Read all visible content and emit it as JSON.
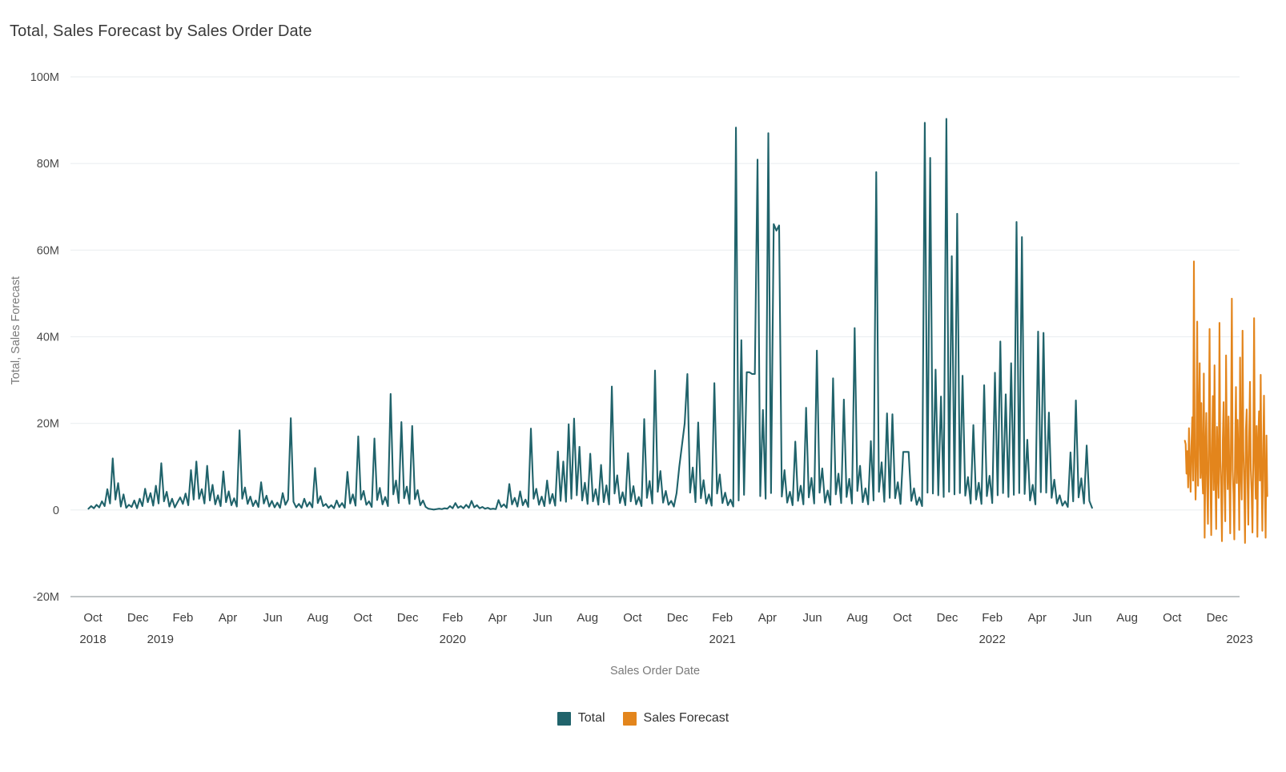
{
  "chart_data": {
    "type": "line",
    "title": "Total, Sales Forecast by Sales Order Date",
    "xlabel": "Sales Order Date",
    "ylabel": "Total, Sales Forecast",
    "ylim": [
      -20000000,
      100000000
    ],
    "ytick_labels": [
      "100M",
      "80M",
      "60M",
      "40M",
      "20M",
      "0",
      "-20M"
    ],
    "ytick_values": [
      100000000,
      80000000,
      60000000,
      40000000,
      20000000,
      0,
      -20000000
    ],
    "grid": true,
    "legend_position": "bottom",
    "xlim_months": [
      "2018-09",
      "2023-01"
    ],
    "xtick_labels": [
      "Oct",
      "Dec",
      "Feb",
      "Apr",
      "Jun",
      "Aug",
      "Oct",
      "Dec",
      "Feb",
      "Apr",
      "Jun",
      "Aug",
      "Oct",
      "Dec",
      "Feb",
      "Apr",
      "Jun",
      "Aug",
      "Oct",
      "Dec",
      "Feb",
      "Apr",
      "Jun",
      "Aug",
      "Oct",
      "Dec"
    ],
    "xtick_months": [
      "2018-10",
      "2018-12",
      "2019-02",
      "2019-04",
      "2019-06",
      "2019-08",
      "2019-10",
      "2019-12",
      "2020-02",
      "2020-04",
      "2020-06",
      "2020-08",
      "2020-10",
      "2020-12",
      "2021-02",
      "2021-04",
      "2021-06",
      "2021-08",
      "2021-10",
      "2021-12",
      "2022-02",
      "2022-04",
      "2022-06",
      "2022-08",
      "2022-10",
      "2022-12"
    ],
    "year_labels": [
      {
        "text": "2018",
        "month": "2018-10"
      },
      {
        "text": "2019",
        "month": "2019-01"
      },
      {
        "text": "2020",
        "month": "2020-02"
      },
      {
        "text": "2021",
        "month": "2021-02"
      },
      {
        "text": "2022",
        "month": "2022-02"
      },
      {
        "text": "2023",
        "month": "2023-01"
      }
    ],
    "colors": {
      "total": "#20636B",
      "sales_forecast": "#E3851C",
      "grid": "#eceff1",
      "axis": "#9aa0a3",
      "text": "#3d3d3d",
      "axis_title": "#7a7a7a",
      "title": "#3a3a3a"
    },
    "series": [
      {
        "name": "Total",
        "color": "#20636B",
        "start_month": "2018-09-25",
        "point_spacing_days": 3.6,
        "values": [
          300000,
          900000,
          400000,
          1200000,
          600000,
          2000000,
          900000,
          4800000,
          1500000,
          11900000,
          2400000,
          6200000,
          800000,
          3600000,
          500000,
          1200000,
          700000,
          2200000,
          400000,
          2600000,
          900000,
          4900000,
          1800000,
          3900000,
          1000000,
          5600000,
          1500000,
          10800000,
          2000000,
          4200000,
          800000,
          2600000,
          600000,
          1800000,
          2900000,
          1400000,
          3800000,
          1100000,
          9200000,
          2400000,
          11200000,
          2600000,
          4800000,
          1500000,
          10200000,
          2200000,
          5800000,
          1300000,
          3400000,
          900000,
          8900000,
          1800000,
          4300000,
          1100000,
          2700000,
          800000,
          18400000,
          2600000,
          5200000,
          1400000,
          3100000,
          900000,
          2200000,
          700000,
          6400000,
          1500000,
          3300000,
          800000,
          2100000,
          600000,
          1700000,
          500000,
          3900000,
          1200000,
          2400000,
          21200000,
          1900000,
          600000,
          1400000,
          500000,
          2600000,
          800000,
          1800000,
          600000,
          9700000,
          1600000,
          3200000,
          900000,
          1400000,
          500000,
          1100000,
          400000,
          2200000,
          700000,
          1600000,
          500000,
          8800000,
          1500000,
          3600000,
          1000000,
          17000000,
          2400000,
          4400000,
          1200000,
          2000000,
          700000,
          16500000,
          2300000,
          5100000,
          1300000,
          3000000,
          900000,
          26800000,
          3600000,
          6800000,
          1600000,
          20300000,
          2700000,
          5400000,
          1400000,
          19400000,
          2500000,
          4600000,
          1100000,
          2200000,
          700000,
          300000,
          200000,
          100000,
          200000,
          300000,
          200000,
          400000,
          300000,
          900000,
          400000,
          1600000,
          500000,
          900000,
          400000,
          1200000,
          500000,
          2100000,
          600000,
          1100000,
          400000,
          700000,
          300000,
          500000,
          200000,
          300000,
          200000,
          2300000,
          700000,
          1300000,
          500000,
          6000000,
          1300000,
          2800000,
          800000,
          4300000,
          1100000,
          2400000,
          700000,
          18800000,
          2600000,
          4900000,
          1200000,
          3100000,
          900000,
          6800000,
          1500000,
          3700000,
          1000000,
          13500000,
          2100000,
          11200000,
          1900000,
          19800000,
          2600000,
          21100000,
          3400000,
          14600000,
          2200000,
          6300000,
          1400000,
          13000000,
          2000000,
          4800000,
          1200000,
          10400000,
          1800000,
          5700000,
          1300000,
          28500000,
          3800000,
          8000000,
          1600000,
          4100000,
          1100000,
          13100000,
          2000000,
          5500000,
          1300000,
          3000000,
          900000,
          21000000,
          2800000,
          6700000,
          1500000,
          32200000,
          4200000,
          9000000,
          1700000,
          4400000,
          1200000,
          2100000,
          800000,
          3900000,
          10000000,
          15000000,
          20000000,
          31400000,
          4000000,
          9800000,
          1800000,
          20200000,
          2700000,
          6900000,
          1500000,
          3600000,
          1000000,
          29300000,
          3800000,
          8200000,
          1600000,
          4000000,
          1100000,
          2400000,
          800000,
          88300000,
          2200000,
          39200000,
          3500000,
          31800000,
          31800000,
          31400000,
          31400000,
          80900000,
          3200000,
          23100000,
          2600000,
          87000000,
          3900000,
          66000000,
          64500000,
          65700000,
          3100000,
          9200000,
          1700000,
          4200000,
          1100000,
          15800000,
          2100000,
          5600000,
          1300000,
          23600000,
          2900000,
          7400000,
          1500000,
          36800000,
          4000000,
          9600000,
          1700000,
          4500000,
          1200000,
          30400000,
          3600000,
          8400000,
          1600000,
          25500000,
          3000000,
          7200000,
          1500000,
          42000000,
          4400000,
          10200000,
          1800000,
          5000000,
          1300000,
          15900000,
          2200000,
          78000000,
          4200000,
          11000000,
          1900000,
          22300000,
          2800000,
          22100000,
          2700000,
          6400000,
          1400000,
          13400000,
          13400000,
          13400000,
          2100000,
          5000000,
          1200000,
          2900000,
          900000,
          89400000,
          4000000,
          81300000,
          3800000,
          32400000,
          3400000,
          26200000,
          3000000,
          90300000,
          4200000,
          58600000,
          3600000,
          68400000,
          3900000,
          31000000,
          3300000,
          7600000,
          1500000,
          19600000,
          2400000,
          6300000,
          1400000,
          28800000,
          3200000,
          7900000,
          1600000,
          31700000,
          3400000,
          38900000,
          3900000,
          26700000,
          3000000,
          33900000,
          3500000,
          66500000,
          3900000,
          63000000,
          3700000,
          16200000,
          2200000,
          5800000,
          1300000,
          41200000,
          4100000,
          40900000,
          4000000,
          22500000,
          2800000,
          7000000,
          1500000,
          3400000,
          1000000,
          2000000,
          700000,
          13300000,
          2000000,
          25300000,
          2900000,
          7300000,
          1500000,
          14900000,
          2100000,
          500000
        ]
      },
      {
        "name": "Sales Forecast",
        "color": "#E3851C",
        "start_month": "2022-10-18",
        "point_spacing_days": 1.1,
        "values": [
          16000000,
          15200000,
          8400000,
          13600000,
          5200000,
          18900000,
          9800000,
          4200000,
          14800000,
          21400000,
          6800000,
          57400000,
          13800000,
          2400000,
          11600000,
          43500000,
          5600000,
          19800000,
          33900000,
          7400000,
          24700000,
          9200000,
          3800000,
          31500000,
          -6400000,
          12800000,
          22400000,
          5400000,
          -3200000,
          16200000,
          41800000,
          8200000,
          -5800000,
          14400000,
          26300000,
          4600000,
          33400000,
          7800000,
          -4400000,
          19200000,
          9600000,
          2800000,
          43200000,
          11400000,
          5200000,
          -7200000,
          15800000,
          24900000,
          6400000,
          -2600000,
          35700000,
          13200000,
          4800000,
          21600000,
          8400000,
          -5400000,
          17800000,
          48800000,
          9200000,
          3600000,
          -6800000,
          14200000,
          28400000,
          6200000,
          20800000,
          11800000,
          -4600000,
          35200000,
          8800000,
          2400000,
          41400000,
          13600000,
          5800000,
          -7600000,
          18400000,
          23200000,
          7200000,
          -3400000,
          16800000,
          29600000,
          9400000,
          4200000,
          -5200000,
          12400000,
          44300000,
          10800000,
          2600000,
          19400000,
          -6200000,
          15600000,
          22800000,
          6800000,
          31200000,
          8600000,
          -4800000,
          13800000,
          26400000,
          5400000,
          -6400000,
          17200000,
          3200000
        ]
      }
    ]
  },
  "legend": {
    "items": [
      {
        "label": "Total",
        "color": "#20636B"
      },
      {
        "label": "Sales Forecast",
        "color": "#E3851C"
      }
    ]
  }
}
